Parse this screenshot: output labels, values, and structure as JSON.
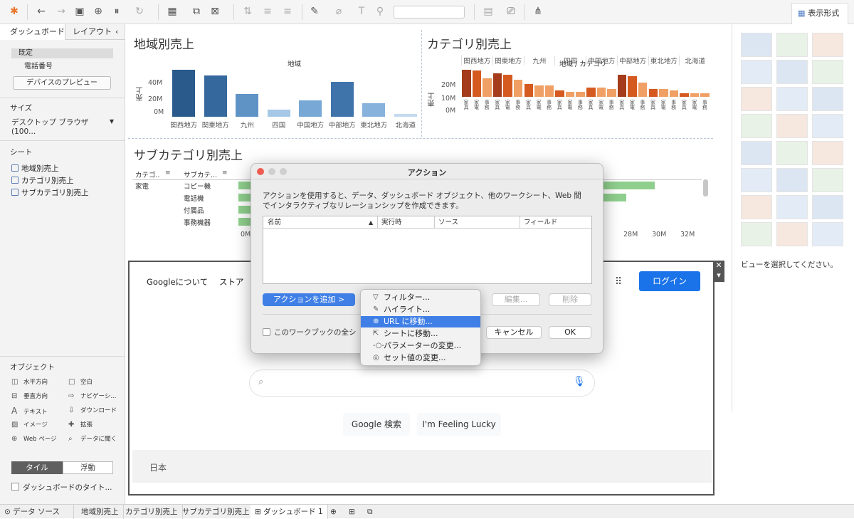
{
  "toolbar": {
    "show_me_label": "表示形式"
  },
  "left_panel": {
    "tab_dashboard": "ダッシュボード",
    "tab_layout": "レイアウト",
    "device_selected": "既定",
    "device_phone": "電話番号",
    "device_preview_button": "デバイスのプレビュー",
    "size_title": "サイズ",
    "size_value": "デスクトップ ブラウザ (100...",
    "sheets_title": "シート",
    "sheets": [
      "地域別売上",
      "カテゴリ別売上",
      "サブカテゴリ別売上"
    ],
    "objects_title": "オブジェクト",
    "objects": [
      {
        "label": "水平方向",
        "icon": "horizontal-icon"
      },
      {
        "label": "空白",
        "icon": "blank-icon"
      },
      {
        "label": "垂直方向",
        "icon": "vertical-icon"
      },
      {
        "label": "ナビゲーシ...",
        "icon": "navigation-icon"
      },
      {
        "label": "テキスト",
        "icon": "text-icon"
      },
      {
        "label": "ダウンロード",
        "icon": "download-icon"
      },
      {
        "label": "イメージ",
        "icon": "image-icon"
      },
      {
        "label": "拡張",
        "icon": "extension-icon"
      },
      {
        "label": "Web ページ",
        "icon": "web-page-icon"
      },
      {
        "label": "データに聞く",
        "icon": "ask-data-icon"
      }
    ],
    "tile_label": "タイル",
    "float_label": "浮動",
    "show_title_label": "ダッシュボードのタイト..."
  },
  "right_panel": {
    "hint": "ビューを選択してください。"
  },
  "region_chart": {
    "title": "地域別売上",
    "header": "地域",
    "ylabel": "売上",
    "ticks": [
      "40M",
      "20M",
      "0M"
    ]
  },
  "category_chart": {
    "title": "カテゴリ別売上",
    "header": "地域 / カテゴリ",
    "ylabel": "売上",
    "ticks": [
      "20M",
      "10M",
      "0M"
    ],
    "sub_labels": [
      "家具",
      "家電",
      "事務"
    ]
  },
  "subcategory_chart": {
    "title": "サブカテゴリ別売上",
    "col1": "カテゴ..",
    "col2": "サブカテ...",
    "category": "家電",
    "rows": [
      "コピー機",
      "電話機",
      "付属品",
      "事務機器"
    ],
    "xticks": [
      "0M",
      "28M",
      "30M",
      "32M"
    ]
  },
  "web_page": {
    "about": "Googleについて",
    "store": "ストア",
    "login": "ログイン",
    "search_button": "Google 検索",
    "lucky_button": "I'm Feeling Lucky",
    "footer": "日本"
  },
  "dialog": {
    "title": "アクション",
    "description_line1": "アクションを使用すると、データ、ダッシュボード オブジェクト、他のワークシート、Web 間",
    "description_line2": "でインタラクティブなリレーションシップを作成できます。",
    "columns": [
      "名前",
      "実行時",
      "ソース",
      "フィールド"
    ],
    "add_action": "アクションを追加 >",
    "edit": "編集...",
    "delete": "削除",
    "checkbox_label": "このワークブックの全シ",
    "cancel": "キャンセル",
    "ok": "OK"
  },
  "menu": {
    "items": [
      {
        "label": "フィルター...",
        "icon": "filter-icon"
      },
      {
        "label": "ハイライト...",
        "icon": "highlight-icon"
      },
      {
        "label": "URL に移動...",
        "icon": "url-icon"
      },
      {
        "label": "シートに移動...",
        "icon": "goto-sheet-icon"
      },
      {
        "label": "パラメーターの変更...",
        "icon": "parameter-icon"
      },
      {
        "label": "セット値の変更...",
        "icon": "set-icon"
      }
    ]
  },
  "bottom_tabs": {
    "data_source": "データ ソース",
    "tabs": [
      "地域別売上",
      "カテゴリ別売上",
      "サブカテゴリ別売上",
      "ダッシュボード 1"
    ]
  },
  "chart_data": [
    {
      "type": "bar",
      "title": "地域別売上",
      "categories": [
        "関西地方",
        "関東地方",
        "九州",
        "四国",
        "中国地方",
        "中部地方",
        "東北地方",
        "北海道"
      ],
      "values": [
        46,
        40,
        22,
        7,
        16,
        34,
        13,
        3
      ],
      "ylabel": "売上",
      "ylim": [
        0,
        50
      ]
    },
    {
      "type": "bar",
      "title": "カテゴリ別売上",
      "categories": [
        "関西地方",
        "関東地方",
        "九州",
        "四国",
        "中国地方",
        "中部地方",
        "東北地方",
        "北海道"
      ],
      "series": [
        {
          "name": "家具",
          "values": [
            21,
            18,
            10,
            5,
            7,
            17,
            6,
            3
          ]
        },
        {
          "name": "家電",
          "values": [
            20,
            17,
            9,
            4,
            7,
            16,
            6,
            3
          ]
        },
        {
          "name": "事務",
          "values": [
            14,
            13,
            9,
            4,
            6,
            11,
            5,
            3
          ]
        }
      ],
      "ylabel": "売上",
      "ylim": [
        0,
        23
      ]
    }
  ]
}
